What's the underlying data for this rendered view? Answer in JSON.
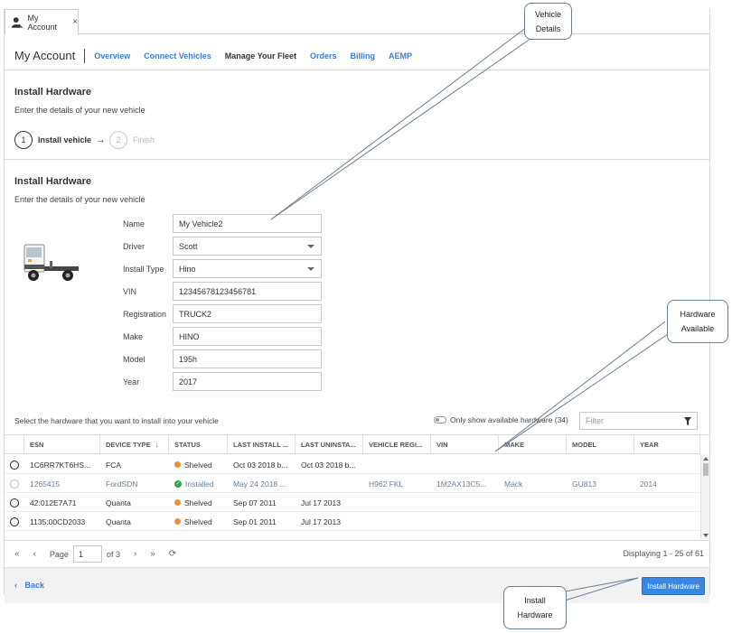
{
  "tab": {
    "label": "My Account",
    "close": "×"
  },
  "header": {
    "title": "My Account",
    "nav": [
      "Overview",
      "Connect Vehicles",
      "Manage Your Fleet",
      "Orders",
      "Billing",
      "AEMP"
    ]
  },
  "wizard": {
    "title": "Install Hardware",
    "subtitle": "Enter the details of your new vehicle",
    "steps": [
      {
        "num": "1",
        "label": "Install vehicle"
      },
      {
        "num": "2",
        "label": "Finish"
      }
    ]
  },
  "details": {
    "title": "Install Hardware",
    "subtitle": "Enter the details of your new vehicle",
    "fields": [
      {
        "label": "Name",
        "value": "My Vehicle2"
      },
      {
        "label": "Driver",
        "value": "Scott"
      },
      {
        "label": "Install Type",
        "value": "Hino"
      },
      {
        "label": "VIN",
        "value": "12345678123456781"
      },
      {
        "label": "Registration",
        "value": "TRUCK2"
      },
      {
        "label": "Make",
        "value": "HINO"
      },
      {
        "label": "Model",
        "value": "195h"
      },
      {
        "label": "Year",
        "value": "2017"
      }
    ]
  },
  "hardware": {
    "prompt": "Select the hardware that you want to install into your vehicle",
    "toggle_label": "Only show available hardware (34)",
    "filter_placeholder": "Filter",
    "columns": [
      "ESN",
      "DEVICE TYPE",
      "STATUS",
      "LAST INSTALL ...",
      "LAST UNINSTA...",
      "VEHICLE REGI...",
      "VIN",
      "MAKE",
      "MODEL",
      "YEAR"
    ],
    "rows": [
      {
        "esn": "1C6RR7KT6HS...",
        "device": "FCA",
        "status": "Shelved",
        "last_install": "Oct 03 2018 b...",
        "last_uninstall": "Oct 03 2018 b...",
        "reg": "",
        "vin": "",
        "make": "",
        "model": "",
        "year": ""
      },
      {
        "esn": "1265415",
        "device": "FordSDN",
        "status": "Installed",
        "last_install": "May 24 2018 ...",
        "last_uninstall": "",
        "reg": "H962 FKL",
        "vin": "1M2AX13C5...",
        "make": "Mack",
        "model": "GU813",
        "year": "2014"
      },
      {
        "esn": "42:012E7A71",
        "device": "Quanta",
        "status": "Shelved",
        "last_install": "Sep 07 2011",
        "last_uninstall": "Jul 17 2013",
        "reg": "",
        "vin": "",
        "make": "",
        "model": "",
        "year": ""
      },
      {
        "esn": "1135:00CD2033",
        "device": "Quanta",
        "status": "Shelved",
        "last_install": "Sep 01 2011",
        "last_uninstall": "Jul 17 2013",
        "reg": "",
        "vin": "",
        "make": "",
        "model": "",
        "year": ""
      }
    ]
  },
  "pager": {
    "page_label": "Page",
    "page": "1",
    "of": "of 3",
    "display": "Displaying 1 - 25 of 61"
  },
  "footer": {
    "back": "Back",
    "install": "Install Hardware"
  },
  "callouts": {
    "vehicle": [
      "Vehicle",
      "Details"
    ],
    "hardware": [
      "Hardware",
      "Available"
    ],
    "install": [
      "Install",
      "Hardware"
    ]
  },
  "colors": {
    "accent": "#3b87e0",
    "link": "#3b7dd8",
    "shelved": "#f28c38",
    "installed": "#2ca44f"
  }
}
